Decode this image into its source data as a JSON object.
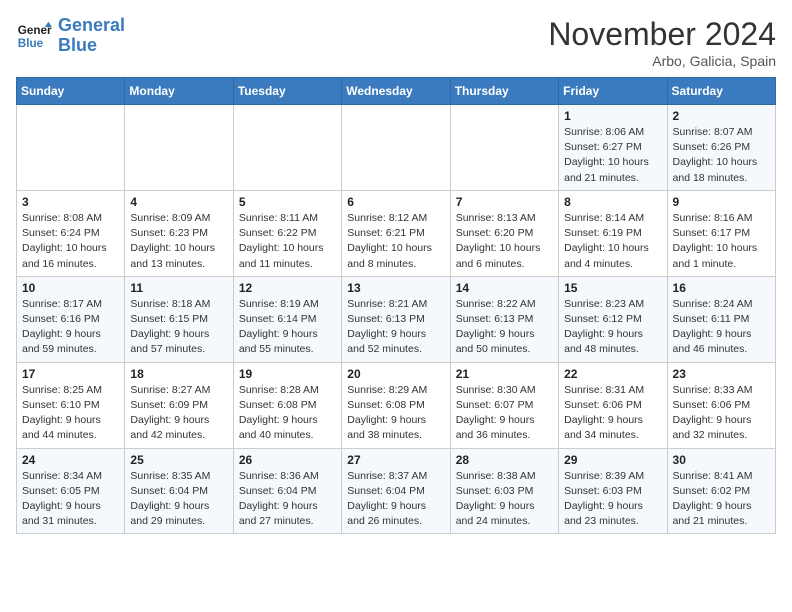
{
  "header": {
    "logo_line1": "General",
    "logo_line2": "Blue",
    "month": "November 2024",
    "location": "Arbo, Galicia, Spain"
  },
  "weekdays": [
    "Sunday",
    "Monday",
    "Tuesday",
    "Wednesday",
    "Thursday",
    "Friday",
    "Saturday"
  ],
  "weeks": [
    [
      {
        "day": "",
        "info": ""
      },
      {
        "day": "",
        "info": ""
      },
      {
        "day": "",
        "info": ""
      },
      {
        "day": "",
        "info": ""
      },
      {
        "day": "",
        "info": ""
      },
      {
        "day": "1",
        "info": "Sunrise: 8:06 AM\nSunset: 6:27 PM\nDaylight: 10 hours\nand 21 minutes."
      },
      {
        "day": "2",
        "info": "Sunrise: 8:07 AM\nSunset: 6:26 PM\nDaylight: 10 hours\nand 18 minutes."
      }
    ],
    [
      {
        "day": "3",
        "info": "Sunrise: 8:08 AM\nSunset: 6:24 PM\nDaylight: 10 hours\nand 16 minutes."
      },
      {
        "day": "4",
        "info": "Sunrise: 8:09 AM\nSunset: 6:23 PM\nDaylight: 10 hours\nand 13 minutes."
      },
      {
        "day": "5",
        "info": "Sunrise: 8:11 AM\nSunset: 6:22 PM\nDaylight: 10 hours\nand 11 minutes."
      },
      {
        "day": "6",
        "info": "Sunrise: 8:12 AM\nSunset: 6:21 PM\nDaylight: 10 hours\nand 8 minutes."
      },
      {
        "day": "7",
        "info": "Sunrise: 8:13 AM\nSunset: 6:20 PM\nDaylight: 10 hours\nand 6 minutes."
      },
      {
        "day": "8",
        "info": "Sunrise: 8:14 AM\nSunset: 6:19 PM\nDaylight: 10 hours\nand 4 minutes."
      },
      {
        "day": "9",
        "info": "Sunrise: 8:16 AM\nSunset: 6:17 PM\nDaylight: 10 hours\nand 1 minute."
      }
    ],
    [
      {
        "day": "10",
        "info": "Sunrise: 8:17 AM\nSunset: 6:16 PM\nDaylight: 9 hours\nand 59 minutes."
      },
      {
        "day": "11",
        "info": "Sunrise: 8:18 AM\nSunset: 6:15 PM\nDaylight: 9 hours\nand 57 minutes."
      },
      {
        "day": "12",
        "info": "Sunrise: 8:19 AM\nSunset: 6:14 PM\nDaylight: 9 hours\nand 55 minutes."
      },
      {
        "day": "13",
        "info": "Sunrise: 8:21 AM\nSunset: 6:13 PM\nDaylight: 9 hours\nand 52 minutes."
      },
      {
        "day": "14",
        "info": "Sunrise: 8:22 AM\nSunset: 6:13 PM\nDaylight: 9 hours\nand 50 minutes."
      },
      {
        "day": "15",
        "info": "Sunrise: 8:23 AM\nSunset: 6:12 PM\nDaylight: 9 hours\nand 48 minutes."
      },
      {
        "day": "16",
        "info": "Sunrise: 8:24 AM\nSunset: 6:11 PM\nDaylight: 9 hours\nand 46 minutes."
      }
    ],
    [
      {
        "day": "17",
        "info": "Sunrise: 8:25 AM\nSunset: 6:10 PM\nDaylight: 9 hours\nand 44 minutes."
      },
      {
        "day": "18",
        "info": "Sunrise: 8:27 AM\nSunset: 6:09 PM\nDaylight: 9 hours\nand 42 minutes."
      },
      {
        "day": "19",
        "info": "Sunrise: 8:28 AM\nSunset: 6:08 PM\nDaylight: 9 hours\nand 40 minutes."
      },
      {
        "day": "20",
        "info": "Sunrise: 8:29 AM\nSunset: 6:08 PM\nDaylight: 9 hours\nand 38 minutes."
      },
      {
        "day": "21",
        "info": "Sunrise: 8:30 AM\nSunset: 6:07 PM\nDaylight: 9 hours\nand 36 minutes."
      },
      {
        "day": "22",
        "info": "Sunrise: 8:31 AM\nSunset: 6:06 PM\nDaylight: 9 hours\nand 34 minutes."
      },
      {
        "day": "23",
        "info": "Sunrise: 8:33 AM\nSunset: 6:06 PM\nDaylight: 9 hours\nand 32 minutes."
      }
    ],
    [
      {
        "day": "24",
        "info": "Sunrise: 8:34 AM\nSunset: 6:05 PM\nDaylight: 9 hours\nand 31 minutes."
      },
      {
        "day": "25",
        "info": "Sunrise: 8:35 AM\nSunset: 6:04 PM\nDaylight: 9 hours\nand 29 minutes."
      },
      {
        "day": "26",
        "info": "Sunrise: 8:36 AM\nSunset: 6:04 PM\nDaylight: 9 hours\nand 27 minutes."
      },
      {
        "day": "27",
        "info": "Sunrise: 8:37 AM\nSunset: 6:04 PM\nDaylight: 9 hours\nand 26 minutes."
      },
      {
        "day": "28",
        "info": "Sunrise: 8:38 AM\nSunset: 6:03 PM\nDaylight: 9 hours\nand 24 minutes."
      },
      {
        "day": "29",
        "info": "Sunrise: 8:39 AM\nSunset: 6:03 PM\nDaylight: 9 hours\nand 23 minutes."
      },
      {
        "day": "30",
        "info": "Sunrise: 8:41 AM\nSunset: 6:02 PM\nDaylight: 9 hours\nand 21 minutes."
      }
    ]
  ]
}
